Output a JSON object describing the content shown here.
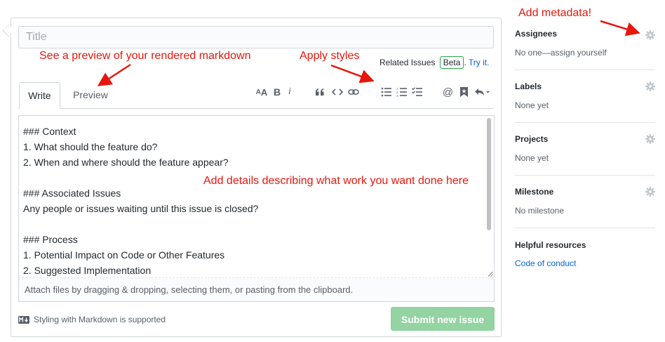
{
  "colors": {
    "annotation": "#e8160c",
    "submit_bg": "#94d3a2",
    "link": "#0366d6",
    "beta_border": "#28a745"
  },
  "form": {
    "title_placeholder": "Title",
    "related_issues": "Related Issues",
    "beta_badge": "Beta",
    "period": ".",
    "try_it": "Try it.",
    "tabs": {
      "write": "Write",
      "preview": "Preview"
    },
    "toolbar": [
      {
        "name": "header-icon",
        "glyph": "AA"
      },
      {
        "name": "bold-icon",
        "glyph": "B"
      },
      {
        "name": "italic-icon",
        "glyph": "i"
      },
      {
        "name": "quote-icon",
        "glyph": "❝"
      },
      {
        "name": "code-icon",
        "glyph": "<>"
      },
      {
        "name": "link-icon",
        "glyph": "⚭"
      },
      {
        "name": "bulleted-list-icon",
        "glyph": "☰"
      },
      {
        "name": "numbered-list-icon",
        "glyph": "☷"
      },
      {
        "name": "task-list-icon",
        "glyph": "☑"
      },
      {
        "name": "mention-icon",
        "glyph": "@"
      },
      {
        "name": "saved-reply-icon",
        "glyph": "🔖"
      },
      {
        "name": "reply-icon",
        "glyph": "↩"
      }
    ],
    "body_lines": [
      "### Context",
      "1. What should the feature do?",
      "2. When and where should the feature appear?",
      "",
      "### Associated Issues",
      "Any people or issues waiting until this issue is closed?",
      "",
      "### Process",
      "1. Potential Impact on Code or Other Features",
      "2. Suggested Implementation"
    ],
    "attach_hint": "Attach files by dragging & dropping, selecting them, or pasting from the clipboard.",
    "markdown_note": "Styling with Markdown is supported",
    "markdown_badge": "M↓",
    "submit_label": "Submit new issue"
  },
  "sidebar": {
    "assignees": {
      "heading": "Assignees",
      "value": "No one—assign yourself"
    },
    "labels": {
      "heading": "Labels",
      "value": "None yet"
    },
    "projects": {
      "heading": "Projects",
      "value": "None yet"
    },
    "milestone": {
      "heading": "Milestone",
      "value": "No milestone"
    },
    "resources": {
      "heading": "Helpful resources",
      "link": "Code of conduct"
    }
  },
  "annotations": {
    "metadata": "Add metadata!",
    "preview": "See a preview of your rendered markdown",
    "styles": "Apply styles",
    "details": "Add details describing what work you want done here"
  }
}
